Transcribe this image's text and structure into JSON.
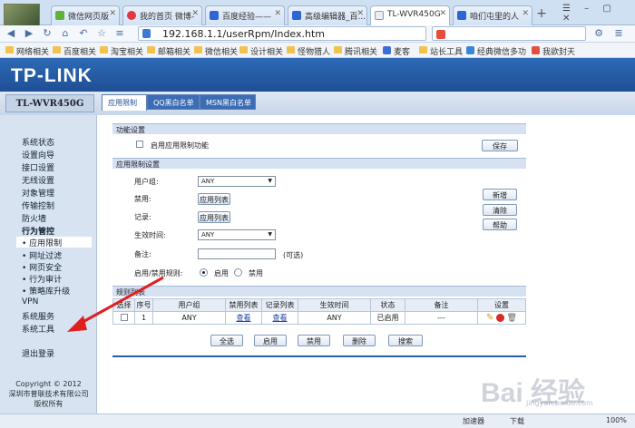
{
  "browser": {
    "tabs": [
      {
        "label": "微信网页版"
      },
      {
        "label": "我的首页 微博-"
      },
      {
        "label": "百度经验——"
      },
      {
        "label": "高级编辑器_百..."
      },
      {
        "label": "TL-WVR450G"
      },
      {
        "label": "咱们屯里的人"
      }
    ],
    "new_tab": "+",
    "window_controls": "☰ – ▢ ✕",
    "url": "192.168.1.1/userRpm/Index.htm",
    "search_placeholder": "",
    "bookmarks": [
      "网络相关",
      "百度相关",
      "淘宝相关",
      "邮箱相关",
      "微信相关",
      "设计相关",
      "怪物猎人",
      "腾讯相关",
      "麦客",
      "站长工具",
      "经典微信多功",
      "我欲封天"
    ]
  },
  "router": {
    "brand": "TP-LINK",
    "model": "TL-WVR450G",
    "page_tabs": [
      "应用限制",
      "QQ黑白名单",
      "MSN黑白名单"
    ],
    "sidebar": [
      {
        "label": "系统状态"
      },
      {
        "label": "设置向导"
      },
      {
        "label": "接口设置"
      },
      {
        "label": "无线设置"
      },
      {
        "label": "对象管理"
      },
      {
        "label": "传输控制"
      },
      {
        "label": "防火墙"
      },
      {
        "label": "行为管控"
      },
      {
        "label": "• 应用限制"
      },
      {
        "label": "• 网址过滤"
      },
      {
        "label": "• 网页安全"
      },
      {
        "label": "• 行为审计"
      },
      {
        "label": "• 策略库升级"
      },
      {
        "label": "VPN"
      },
      {
        "label": "系统服务"
      },
      {
        "label": "系统工具"
      },
      {
        "label": "退出登录"
      }
    ],
    "copyright": [
      "Copyright © 2012",
      "深圳市普联技术有限公司",
      "版权所有"
    ],
    "func_section": {
      "title": "功能设置",
      "enable_label": "启用应用限制功能",
      "save": "保存"
    },
    "rule_section": {
      "title": "应用限制设置",
      "user_group_label": "用户组:",
      "user_group_value": "ANY",
      "block_label": "禁用:",
      "block_btn": "应用列表",
      "log_label": "记录:",
      "log_btn": "应用列表",
      "time_label": "生效时间:",
      "time_value": "ANY",
      "note_label": "备注:",
      "note_value": "",
      "optional": "(可选)",
      "enable_rule_label": "启用/禁用规则:",
      "enable_opt": "启用",
      "disable_opt": "禁用",
      "add": "新增",
      "clear": "清除",
      "help": "帮助"
    },
    "rule_list": {
      "title": "规则列表",
      "headers": [
        "选择",
        "序号",
        "用户组",
        "禁用列表",
        "记录列表",
        "生效时间",
        "状态",
        "备注",
        "设置"
      ],
      "rows": [
        {
          "index": "1",
          "group": "ANY",
          "block": "查看",
          "log": "查看",
          "time": "ANY",
          "status": "已启用",
          "note": "---"
        }
      ],
      "buttons": [
        "全选",
        "启用",
        "禁用",
        "删除",
        "搜索"
      ]
    }
  },
  "statusbar": {
    "items": [
      "加速器",
      "下载"
    ],
    "zoom": "100%"
  },
  "watermark": {
    "text": "Bai 经验",
    "sub": "jingyan.baidu.com"
  }
}
